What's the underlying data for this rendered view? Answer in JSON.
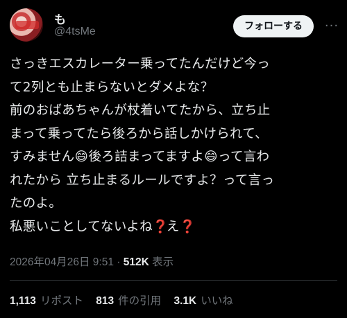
{
  "user": {
    "name": "も",
    "handle": "@4tsMe",
    "follow_label": "フォローする",
    "more_label": "···"
  },
  "tweet": {
    "lines": [
      "さっきエスカレーター乗ってたんだけど今っ",
      "て2列とも止まらないとダメよな？",
      "前のおばあちゃんが杖着いてたから、立ち止",
      "まって乗ってたら後ろから話しかけられて、",
      "すみません|😄|後ろ詰まってますよ|😄|って言わ",
      "れたから 立ち止まるルールですよ？って言っ",
      "たのよ。",
      "私悪いことしてないよね|❓|え|❓|"
    ]
  },
  "meta": {
    "date": "2026年04月26日 9:51",
    "separator": "·",
    "views_count": "512K",
    "views_label": "表示"
  },
  "stats": {
    "reposts_count": "1,113",
    "reposts_label": "リポスト",
    "quotes_count": "813",
    "quotes_label": "件の引用",
    "likes_count": "3.1K",
    "likes_label": "いいね"
  }
}
